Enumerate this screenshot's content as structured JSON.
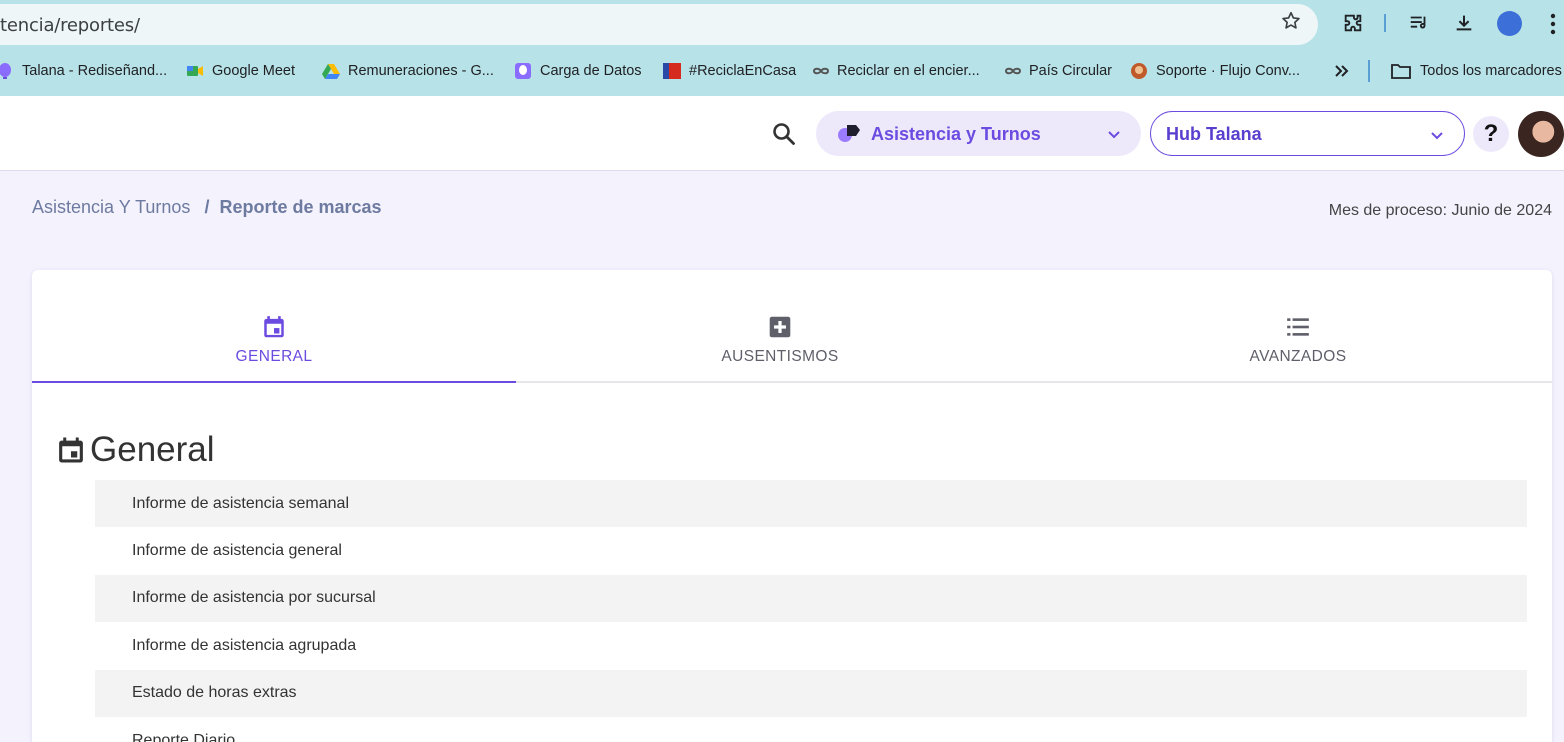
{
  "browser": {
    "url": "tencia/reportes/",
    "bookmarks": [
      {
        "label": "Talana - Rediseñand...",
        "icon": "balloon-icon",
        "color": "#7b5cff"
      },
      {
        "label": "Google Meet",
        "icon": "google-meet-icon",
        "color": "#34a853"
      },
      {
        "label": "Remuneraciones - G...",
        "icon": "google-drive-icon",
        "color": "#4285f4"
      },
      {
        "label": "Carga de Datos",
        "icon": "balloon-icon",
        "color": "#7b5cff"
      },
      {
        "label": "#ReciclaEnCasa",
        "icon": "chile-flag-icon",
        "color": "#d52b1e"
      },
      {
        "label": "Reciclar en el encier...",
        "icon": "infinity-icon",
        "color": "#555555"
      },
      {
        "label": "País Circular",
        "icon": "infinity-icon",
        "color": "#555555"
      },
      {
        "label": "Soporte · Flujo Conv...",
        "icon": "support-avatar-icon",
        "color": "#c05a2a"
      }
    ],
    "all_bookmarks_label": "Todos los marcadores"
  },
  "header": {
    "module_label": "Asistencia y Turnos",
    "hub_label": "Hub Talana",
    "help_label": "?"
  },
  "breadcrumb": {
    "parent": "Asistencia Y Turnos",
    "separator": "/",
    "current": "Reporte de marcas"
  },
  "process_month": "Mes de proceso: Junio de 2024",
  "tabs": [
    {
      "label": "GENERAL",
      "icon": "calendar-icon",
      "active": true
    },
    {
      "label": "AUSENTISMOS",
      "icon": "medical-plus-icon",
      "active": false
    },
    {
      "label": "AVANZADOS",
      "icon": "list-icon",
      "active": false
    }
  ],
  "section": {
    "title": "General",
    "icon": "calendar-icon"
  },
  "reports": [
    "Informe de asistencia semanal",
    "Informe de asistencia general",
    "Informe de asistencia por sucursal",
    "Informe de asistencia agrupada",
    "Estado de horas extras",
    "Reporte Diario"
  ],
  "colors": {
    "accent": "#6c4be0",
    "chrome_bg": "#b7e3e8",
    "page_bg": "#f4f2fd"
  }
}
